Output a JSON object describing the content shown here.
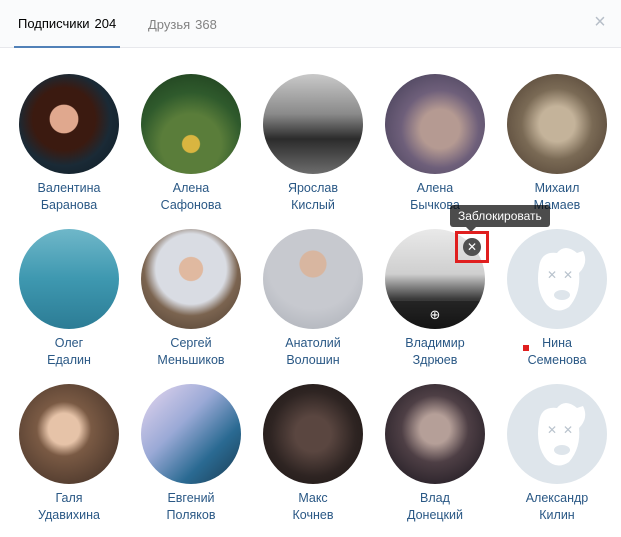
{
  "tabs": [
    {
      "label": "Подписчики",
      "count": "204"
    },
    {
      "label": "Друзья",
      "count": "368"
    }
  ],
  "close_glyph": "×",
  "tooltip": "Заблокировать",
  "block_glyph": "✕",
  "zoom_glyph": "⊕",
  "colors": {
    "link": "#2a5885",
    "accent": "#5181b8",
    "highlight": "#e01f1f"
  },
  "people": [
    {
      "first": "Валентина",
      "last": "Баранова"
    },
    {
      "first": "Алена",
      "last": "Сафонова"
    },
    {
      "first": "Ярослав",
      "last": "Кислый"
    },
    {
      "first": "Алена",
      "last": "Бычкова"
    },
    {
      "first": "Михаил",
      "last": "Мамаев"
    },
    {
      "first": "Олег",
      "last": "Едалин"
    },
    {
      "first": "Сергей",
      "last": "Меньшиков"
    },
    {
      "first": "Анатолий",
      "last": "Волошин"
    },
    {
      "first": "Владимир",
      "last": "Здрюев"
    },
    {
      "first": "Нина",
      "last": "Семенова"
    },
    {
      "first": "Галя",
      "last": "Удавихина"
    },
    {
      "first": "Евгений",
      "last": "Поляков"
    },
    {
      "first": "Макс",
      "last": "Кочнев"
    },
    {
      "first": "Влад",
      "last": "Донецкий"
    },
    {
      "first": "Александр",
      "last": "Килин"
    }
  ]
}
